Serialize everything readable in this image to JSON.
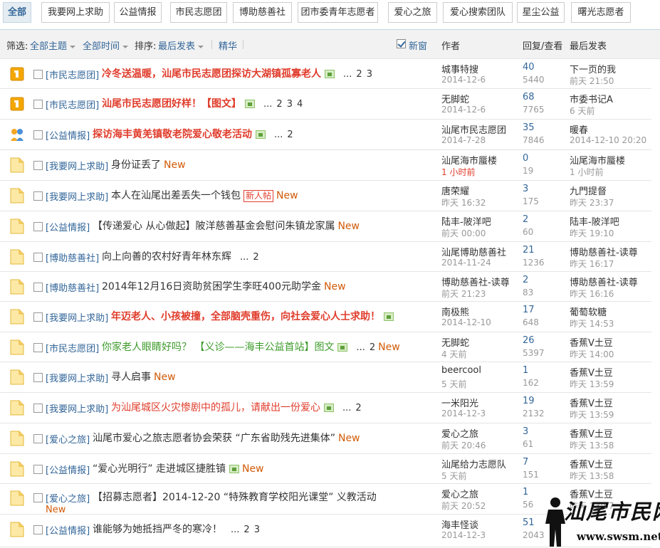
{
  "tabs": [
    "全部",
    "我要网上求助",
    "公益情报",
    "市民志愿团",
    "博助慈善社",
    "团市委青年志愿者",
    "爱心之旅",
    "爱心搜索团队",
    "星尘公益",
    "曙光志愿者"
  ],
  "filter": {
    "label": "筛选:",
    "topics": "全部主题",
    "time": "全部时间",
    "sort_label": "排序:",
    "sort_value": "最后发表",
    "digest": "精华",
    "new_window": "新窗",
    "col_author": "作者",
    "col_stats": "回复/查看",
    "col_last": "最后发表"
  },
  "threads": [
    {
      "icon": "pin",
      "cat": "[市民志愿团]",
      "title": "冷冬送温暖，汕尾市民志愿团探访大湖镇孤寡老人",
      "style": "red",
      "img": true,
      "pages": "... 2 3",
      "author": "城事特搜",
      "adate": "2014-12-6",
      "replies": "40",
      "views": "5440",
      "last": "下一页的我",
      "ldate": "前天 21:50"
    },
    {
      "icon": "pin",
      "cat": "[市民志愿团]",
      "title": "汕尾市民志愿团好样！【图文】",
      "style": "red",
      "img": true,
      "pages": "... 2 3 4",
      "author": "无脚蛇",
      "adate": "2014-12-6",
      "replies": "68",
      "views": "7765",
      "last": "市委书记A",
      "ldate": "6 天前"
    },
    {
      "icon": "hot",
      "cat": "[公益情报]",
      "title": "探访海丰黄羌镇敬老院爱心敬老活动",
      "style": "red",
      "img": true,
      "pages": "... 2",
      "author": "汕尾市民志愿团",
      "adate": "2014-7-28",
      "replies": "35",
      "views": "7846",
      "last": "暖春",
      "ldate": "2014-12-10 20:20"
    },
    {
      "icon": "folder",
      "cat": "[我要网上求助]",
      "title": "身份证丢了",
      "style": "plain",
      "isnew": true,
      "author": "汕尾海市蜃楼",
      "adate": "1 小时前",
      "adatenew": true,
      "replies": "0",
      "views": "19",
      "last": "汕尾海市蜃楼",
      "ldate": "1 小时前"
    },
    {
      "icon": "folder",
      "cat": "[我要网上求助]",
      "title": "本人在汕尾出差丢失一个钱包",
      "style": "plain",
      "newpost": "新人帖",
      "isnew": true,
      "author": "唐荣耀",
      "adate": "昨天 16:32",
      "replies": "3",
      "views": "175",
      "last": "九門提督",
      "ldate": "昨天 23:37"
    },
    {
      "icon": "folder",
      "cat": "[公益情报]",
      "title": "【传递爱心 从心做起】陂洋慈善基金会慰问朱镇龙家属",
      "style": "plain",
      "isnew": true,
      "author": "陆丰-陂洋吧",
      "adate": "前天 00:00",
      "replies": "2",
      "views": "60",
      "last": "陆丰-陂洋吧",
      "ldate": "昨天 19:10"
    },
    {
      "icon": "folder",
      "cat": "[博助慈善社]",
      "title": "向上向善的农村好青年林东辉",
      "style": "plain",
      "pages": "... 2",
      "author": "汕尾博助慈善社",
      "adate": "2014-11-24",
      "replies": "21",
      "views": "1236",
      "last": "博助慈善社-读尊",
      "ldate": "昨天 16:17"
    },
    {
      "icon": "folder",
      "cat": "[博助慈善社]",
      "title": "2014年12月16日资助贫困学生李旺400元助学金",
      "style": "plain",
      "isnew": true,
      "author": "博助慈善社-读尊",
      "adate": "前天 21:23",
      "replies": "2",
      "views": "83",
      "last": "博助慈善社-读尊",
      "ldate": "昨天 16:16"
    },
    {
      "icon": "folder",
      "cat": "[我要网上求助]",
      "title": "年迈老人、小孩被撞，全部脑壳重伤，向社会爱心人士求助！",
      "style": "red",
      "img": true,
      "author": "南极熊",
      "adate": "2014-12-10",
      "replies": "17",
      "views": "648",
      "last": "葡萄软糖",
      "ldate": "昨天 14:53"
    },
    {
      "icon": "folder",
      "cat": "[市民志愿团]",
      "title": "你家老人眼睛好吗？ 【义诊——海丰公益首站】图文",
      "style": "green",
      "img": true,
      "pages": "... 2",
      "isnew": true,
      "author": "无脚蛇",
      "adate": "4 天前",
      "replies": "26",
      "views": "5397",
      "last": "香蕉V土豆",
      "ldate": "昨天 14:00"
    },
    {
      "icon": "folder",
      "cat": "[我要网上求助]",
      "title": "寻人启事",
      "style": "plain",
      "isnew": true,
      "author": "beercool",
      "adate": "5 天前",
      "replies": "1",
      "views": "162",
      "last": "香蕉V土豆",
      "ldate": "昨天 13:59"
    },
    {
      "icon": "folder",
      "cat": "[我要网上求助]",
      "title": "为汕尾城区火灾惨剧中的孤儿，请献出一份爱心",
      "style": "redn",
      "img": true,
      "pages": "... 2",
      "author": "一米阳光",
      "adate": "2014-12-3",
      "replies": "19",
      "views": "2132",
      "last": "香蕉V土豆",
      "ldate": "昨天 13:59"
    },
    {
      "icon": "folder",
      "cat": "[爱心之旅]",
      "title": "汕尾市爱心之旅志愿者协会荣获 “广东省助残先进集体”",
      "style": "plain",
      "isnew": true,
      "author": "爱心之旅",
      "adate": "前天 20:46",
      "replies": "3",
      "views": "61",
      "last": "香蕉V土豆",
      "ldate": "昨天 13:58"
    },
    {
      "icon": "folder",
      "cat": "[公益情报]",
      "title": "“爱心光明行” 走进城区捷胜镇",
      "style": "plain",
      "img": true,
      "isnew": true,
      "author": "汕尾给力志愿队",
      "adate": "5 天前",
      "replies": "7",
      "views": "151",
      "last": "香蕉V土豆",
      "ldate": "昨天 13:58"
    },
    {
      "icon": "folder",
      "cat": "[爱心之旅]",
      "title": "【招募志愿者】2014-12-20 “特殊教育学校阳光课堂” 义教活动",
      "style": "plain",
      "isnew": true,
      "wrapnew": true,
      "author": "爱心之旅",
      "adate": "前天 20:52",
      "replies": "1",
      "views": "56",
      "last": "香蕉V土豆",
      "ldate": "昨天 13:57"
    },
    {
      "icon": "folder",
      "cat": "[公益情报]",
      "title": "谁能够为她抵挡严冬的寒冷！",
      "style": "plain",
      "pages": "... 2 3",
      "author": "海丰怪谈",
      "adate": "2014-12-3",
      "replies": "51",
      "views": "2043",
      "last": "",
      "ldate": ""
    }
  ],
  "new_label": "New",
  "watermark": {
    "text": "汕尾市民网",
    "url": "www.swsm.net"
  }
}
